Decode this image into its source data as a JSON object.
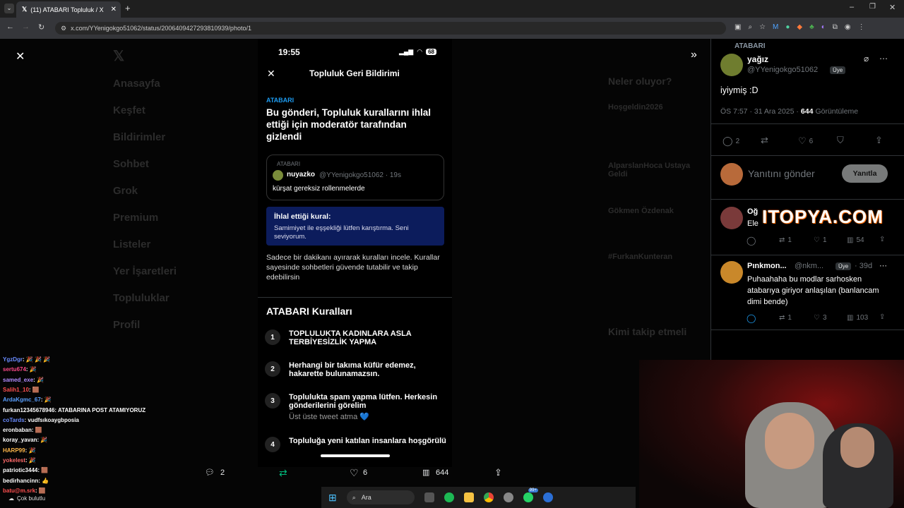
{
  "browser": {
    "tab_title": "(11) ATABARI Topluluk / X",
    "url": "x.com/YYenigokgo51062/status/2006409427293810939/photo/1"
  },
  "background_nav": [
    "Anasayfa",
    "Keşfet",
    "Bildirimler",
    "Sohbet",
    "Grok",
    "Premium",
    "Listeler",
    "Yer İşaretleri",
    "Topluluklar",
    "Profil"
  ],
  "background_right": {
    "heading": "Neler oluyor?",
    "trend1": "Hoşgeldin2026",
    "trend2": "AlparslanHoca Ustaya Geldi",
    "trend3": "Gökmen Özdenak",
    "trend4": "#FurkanKunteran",
    "follow": "Kimi takip etmeli"
  },
  "phone": {
    "time": "19:55",
    "battery": "68",
    "header_title": "Topluluk Geri Bildirimi",
    "community": "ATABARI",
    "headline": "Bu gönderi, Topluluk kurallarını ihlal ettiği için moderatör tarafından gizlendi",
    "quoted": {
      "community": "ATABARI",
      "name": "nuyazko",
      "handle": "@YYenigokgo51062 · 19s",
      "text": "kürşat gereksiz rollenmelerde"
    },
    "violation_label": "İhlal ettiği kural:",
    "violation_text": "Samimiyet ile eşşekliği lütfen karıştırma. Seni seviyorum.",
    "info": "Sadece bir dakikanı ayırarak kuralları incele. Kurallar sayesinde sohbetleri güvende tutabilir ve takip edebilirsin",
    "rules_title": "ATABARI Kuralları",
    "rules": [
      {
        "num": "1",
        "title": "TOPLULUKTA KADINLARA ASLA TERBİYESİZLİK YAPMA",
        "sub": ""
      },
      {
        "num": "2",
        "title": "Herhangi bir takıma küfür edemez, hakarette bulunamazsın.",
        "sub": ""
      },
      {
        "num": "3",
        "title": "Toplulukta spam yapma lütfen. Herkesin gönderilerini görelim",
        "sub": "Üst üste tweet atma 💙"
      },
      {
        "num": "4",
        "title": "Topluluğa yeni katılan insanlara hoşgörülü",
        "sub": ""
      }
    ]
  },
  "photo_bar": {
    "replies": "2",
    "likes": "6",
    "views": "644"
  },
  "post": {
    "community": "ATABARI",
    "author": "yağız",
    "handle": "@YYenigokgo51062",
    "member_badge": "Üye",
    "text": "iyiymiş :D",
    "meta_time": "ÖS 7:57 · 31 Ara 2025 ·",
    "views": "644",
    "views_label": "Görüntüleme",
    "replies": "2",
    "likes": "6",
    "reply_placeholder": "Yanıtını gönder",
    "reply_button": "Yanıtla"
  },
  "replies": [
    {
      "name": "Oğ",
      "text": "Ele",
      "retweets": "1",
      "likes": "1",
      "views": "54",
      "overlay": "ITOPYA.COM"
    },
    {
      "name": "Pınkmon...",
      "handle": "@nkm...",
      "badge": "Üye",
      "time": "· 39d",
      "text": "Puhaahaha bu modlar sarhosken atabarıya giriyor anlaşılan (banlancam dimi bende)",
      "retweets": "1",
      "likes": "3",
      "views": "103"
    }
  ],
  "chat": [
    {
      "user": "YgzDgr",
      "msg": ": 🎉 🎉 🎉",
      "color": "#6a8cff"
    },
    {
      "user": "sertu674",
      "msg": ": 🎉",
      "color": "#ff4a8a"
    },
    {
      "user": "samed_exe",
      "msg": ": 🎉",
      "color": "#b18cff"
    },
    {
      "user": "Salih1_10",
      "msg": ": 🟫",
      "color": "#ff5050"
    },
    {
      "user": "ArdaKgmc_67",
      "msg": ": 🎉",
      "color": "#5aa0ff"
    },
    {
      "user": "furkan12345678946",
      "msg": ": ATABARINA POST ATAMIYORUZ",
      "color": "#ffffff"
    },
    {
      "user": "coTards",
      "msg": ": vudfsıkoaygbposia",
      "color": "#6a8cff"
    },
    {
      "user": "eronbaban",
      "msg": ": 🟫",
      "color": "#ffffff"
    },
    {
      "user": "koray_yavan",
      "msg": ": 🎉",
      "color": "#ffffff"
    },
    {
      "user": "HARP99",
      "msg": ": 🎉",
      "color": "#ffb84a"
    },
    {
      "user": "yokelest",
      "msg": ": 🎉",
      "color": "#ff6a6a"
    },
    {
      "user": "patriotic3444",
      "msg": ": 🟫",
      "color": "#ffffff"
    },
    {
      "user": "bedirhancinn",
      "msg": ": 👍",
      "color": "#ffffff"
    },
    {
      "user": "batu@m.srk",
      "msg": ": 🟫",
      "color": "#ff5050"
    }
  ],
  "weather": "Çok bulutlu",
  "taskbar": {
    "search": "Ara",
    "badge": "99+"
  }
}
